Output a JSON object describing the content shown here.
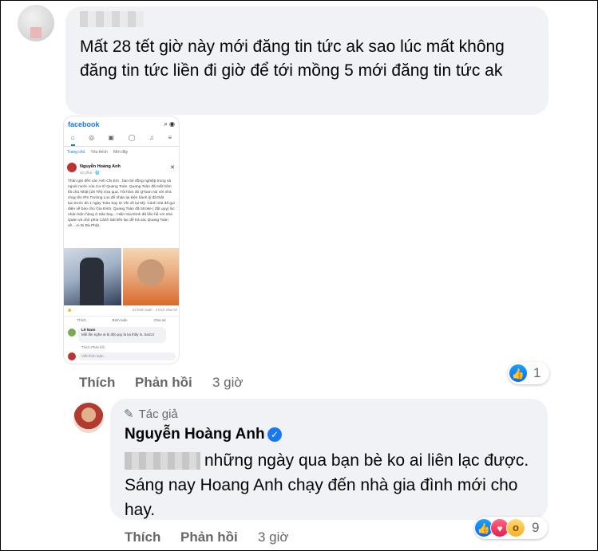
{
  "comment": {
    "text": "Mất 28 tết giờ này mới đăng tin tức ak sao lúc mất không đăng tin tức liền đi giờ để tới mồng 5 mới đăng tin tức ak",
    "actions": {
      "like": "Thích",
      "reply": "Phản hồi",
      "time": "3 giờ"
    },
    "reaction_count": "1",
    "attachment": {
      "app_name": "facebook",
      "tabs": [
        "Trang chủ",
        "Yêu thích",
        "Mới đây"
      ],
      "poster_name": "Nguyễn Hoàng Anh",
      "poster_time": "42 phút · 🌐",
      "post_text": "Thân gửi đến các Anh Chị Em , ban bè đồng nghiệp trong và ngoài nước của Ca Sĩ Quang Toàn. Quang Toàn đã mất hôm tối chủ Nhật (28 Tết) vừa qua. Tối hôm đó QToan nói với nhà chạy lên Phi Trường Los để nhận lại kiện hành lý đã thất lạc,trước đó 1 ngày Toàn bay từ Vhi về lại Mỹ. Cảnh Sát đã gọi điện về báo cho Gia Đình, Quang Toàn đã Stroke ( đột quỵ) lúc nhận kiện hàng ở Sân bay... Hiện Gia Đình đã liên hệ với nhà Quàn và chờ phía Cảnh Sát liên lạc để trả xác Quang Toàn về... Ai Di Đà Phật.",
      "comments_count": "24 bình luận · 4 lượt chia sẻ",
      "post_actions": [
        "Thích",
        "Bình luận",
        "Chia sẻ"
      ],
      "commenter_name": "Lê Nam",
      "commenter_text": "Mỗi lần nghe ai bị đột quỵ là lại thấy lo..haizzz",
      "comment_meta": "Thích   Phản hồi",
      "write_placeholder": "Viết bình luận..."
    }
  },
  "reply": {
    "author_tag": "Tác giả",
    "author_name": "Nguyễn Hoàng Anh",
    "text": "những ngày qua bạn bè ko ai liên lạc được. Sáng nay Hoang Anh chạy đến nhà gia đình mới cho hay.",
    "actions": {
      "like": "Thích",
      "reply": "Phản hồi",
      "time": "3 giờ"
    },
    "reaction_count": "9"
  },
  "icons": {
    "like": "thumbs-up-icon",
    "love": "heart-icon",
    "wow": "wow-icon",
    "verified": "verified-check-icon",
    "author": "pencil-icon"
  },
  "colors": {
    "accent": "#1877f2",
    "bubble": "#f0f2f5",
    "muted": "#65676b"
  }
}
